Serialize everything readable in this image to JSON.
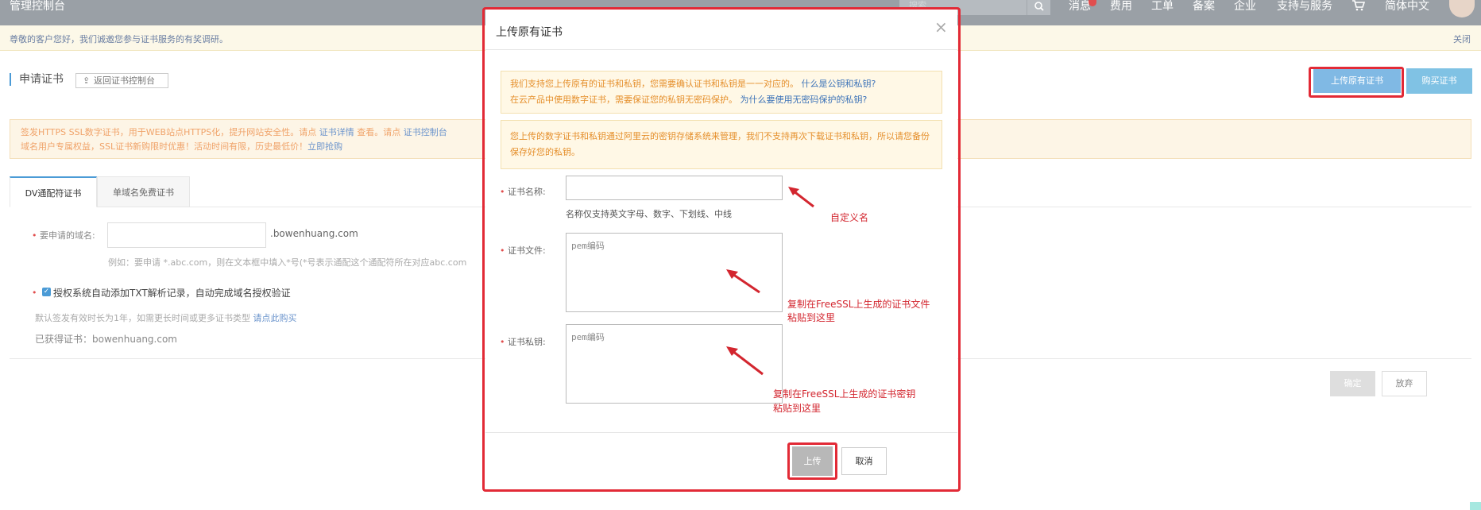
{
  "topbar": {
    "title": "管理控制台",
    "search_placeholder": "搜索",
    "nav": [
      "消息",
      "费用",
      "工单",
      "备案",
      "企业",
      "支持与服务",
      "简体中文"
    ]
  },
  "notice": {
    "text": "尊敬的客户您好，我们诚邀您参与证书服务的有奖调研。",
    "close": "关闭"
  },
  "page": {
    "heading": "申请证书",
    "back_label": "返回证书控制台",
    "upload_label": "上传原有证书",
    "buy_label": "购买证书"
  },
  "warning": {
    "line1_a": "签发HTTPS SSL数字证书，用于WEB站点HTTPS化，提升网站安全性。请点 ",
    "line1_link1": "证书详情",
    "line1_b": " 查看。请点 ",
    "line1_link2": "证书控制台",
    "line2_a": "域名用户专属权益，SSL证书新购限时优惠！活动时间有限，历史最低价！",
    "line2_link": "立即抢购"
  },
  "tabs": [
    "DV通配符证书",
    "单域名免费证书"
  ],
  "form": {
    "domain_label": "要申请的域名:",
    "domain_suffix": ".bowenhuang.com",
    "example": "例如：要申请 *.abc.com，则在文本框中填入*号(*号表示通配这个通配符所在对应abc.com",
    "checkbox_label": "授权系统自动添加TXT解析记录，自动完成域名授权验证",
    "default_note": "默认签发有效时长为1年，如需更长时间或更多证书类型 ",
    "default_link": "请点此购买",
    "obtained": "已获得证书：bowenhuang.com",
    "ok_label": "确定",
    "abandon_label": "放弃"
  },
  "modal": {
    "title": "上传原有证书",
    "info_line1": "我们支持您上传原有的证书和私钥，您需要确认证书和私钥是一一对应的。",
    "info_link1": "什么是公钥和私钥?",
    "info_line2": "在云产品中使用数字证书，需要保证您的私钥无密码保护。",
    "info_link2": "为什么要使用无密码保护的私钥?",
    "info2": "您上传的数字证书和私钥通过阿里云的密钥存储系统来管理，我们不支持再次下载证书和私钥，所以请您备份保存好您的私钥。",
    "name_label": "证书名称:",
    "name_hint": "名称仅支持英文字母、数字、下划线、中线",
    "file_label": "证书文件:",
    "file_placeholder": "pem编码",
    "key_label": "证书私钥:",
    "key_placeholder": "pem编码",
    "upload_label": "上传",
    "cancel_label": "取消"
  },
  "annotations": {
    "custom_name": "自定义名",
    "cert_file_1": "复制在FreeSSL上生成的证书文件",
    "cert_file_2": "粘贴到这里",
    "cert_key_1": "复制在FreeSSL上生成的证书密钥",
    "cert_key_2": "粘贴到这里"
  },
  "colors": {
    "highlight": "#e22a36",
    "annotation": "#d3262f",
    "link": "#3d73b8",
    "accent": "#4b9bd6"
  }
}
